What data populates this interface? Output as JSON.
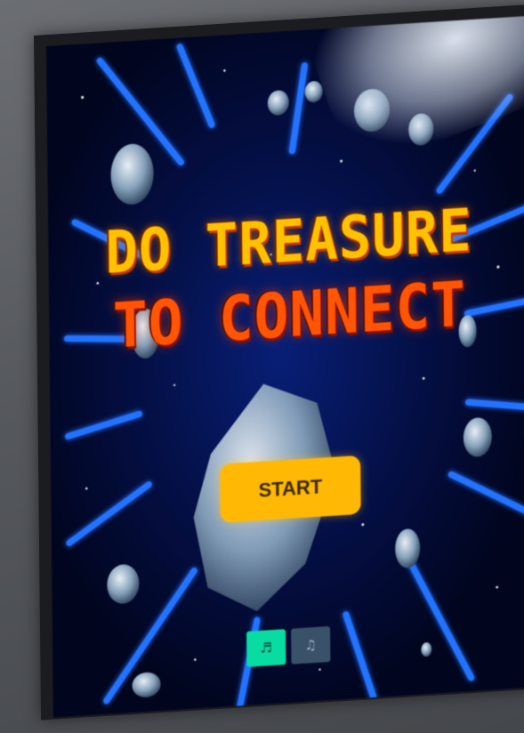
{
  "game": {
    "title_line_1": "DO TREASURE",
    "title_line_2": "TO CONNECT",
    "start_label": "START"
  },
  "controls": {
    "left_icon": "speaker-icon",
    "right_icon": "music-icon"
  },
  "colors": {
    "title_yellow": "#ffc21a",
    "title_orange": "#ff5a14",
    "start_button": "#f6b91c",
    "ray_blue": "#1f6bff",
    "space_bg": "#061040",
    "toggle_active": "#1ed6a4",
    "toggle_inactive": "#3d5166"
  }
}
